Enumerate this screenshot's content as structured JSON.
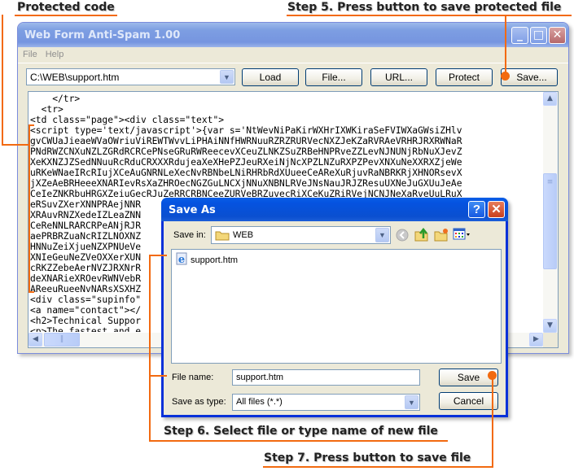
{
  "callouts": {
    "protected_code": "Protected code",
    "step5": "Step 5. Press button to save protected file",
    "step6": "Step 6. Select file or type name of new file",
    "step7": "Step 7. Press button to save file"
  },
  "colors": {
    "accent": "#f26a10",
    "dialog_title": "#0a4fd0",
    "main_title_inactive": "#7d9ee2"
  },
  "main_window": {
    "title": "Web Form Anti-Spam 1.00",
    "menu": [
      "File",
      "Help"
    ],
    "path_combo": {
      "value": "C:\\WEB\\support.htm"
    },
    "buttons": {
      "load": "Load",
      "file": "File...",
      "url": "URL...",
      "protect": "Protect",
      "save": "Save..."
    },
    "code_lines": [
      "    </tr>",
      "  <tr>",
      "<td class=\"page\"><div class=\"text\">",
      "<script type='text/javascript'>{var s='NtWevNiPaKirWXHrIXWKiraSeFVIWXaGWsiZHlv",
      "gvCWUaJieaeWVaOWriuViREWTWvvLiPHAiNNfHWRNuuRZRZRURVecNXZJeKZaRVRAeVRHRJRXRWNaR",
      "PNdRWZCNXuNZLZGRdRCRCePNseGRuRWReecevXCeuZLNKZSuZRBeHNPRveZZLevNJNUNjRbNuXJevZ",
      "XeKXNZJZSedNNuuRcRduCRXXXRdujeaXeXHePZJeuRXeiNjNcXPZLNZuRXPZPevXNXuNeXXRXZjeWe",
      "uRKeWNaeIRcRIujXCeAuGNRNLeXecNvRBNbeLNiRHRbRdXUueeCeAReXuRjuvRaNBRKRjXHNORsevX",
      "jXZeAeBRHeeeXNARIevRsXaZHROecNGZGuLNCXjNNuXNBNLRVeJNsNauJRJZResuUXNeJuGXUuJeAe",
      "CeIeZNKRbuHRGXZeiuGecRJuZeRRCRBNCeeZURVeBRZuvecRiXCeKuZRiRVejNCNJNeXaRveUuLRuX",
      "eRSuvZXerXNNPRAejNNR                                                   uHZSu",
      "XRAuvRNZXedeIZLeaZNN                                                   NueRX",
      "CeReNNLRARCRPeANjRJR                                                   RRRNX",
      "aePRBRZuaNcRIZLNOXNZ                                                   uRRRX",
      "HNNuZeiXjueNZXPNUeVe                                                   ZuNjR",
      "XNIeGeuNeZVeOXXerXUN                                                   eWNHR",
      "cRKZZebeAerNVZJRXNrR                                                   uGePR",
      "deXNARieXROevRWNVebR                                                   RZNeR",
      "AReeuRueeNvNARsXSXHZ                                                   RcNPu",
      "<div class=\"supinfo\"",
      "<a name=\"contact\"></",
      "<h2>Technical Suppor",
      "<p>The fastest and e                                                  lly r"
    ]
  },
  "save_dialog": {
    "title": "Save As",
    "save_in_label": "Save in:",
    "save_in_value": "WEB",
    "files": [
      {
        "name": "support.htm",
        "icon": "ie-html-file-icon"
      }
    ],
    "file_name_label": "File name:",
    "file_name_value": "support.htm",
    "save_as_type_label": "Save as type:",
    "save_as_type_value": "All files (*.*)",
    "buttons": {
      "save": "Save",
      "cancel": "Cancel"
    },
    "toolbar_icons": [
      "back-icon",
      "up-folder-icon",
      "new-folder-icon",
      "view-menu-icon"
    ]
  }
}
